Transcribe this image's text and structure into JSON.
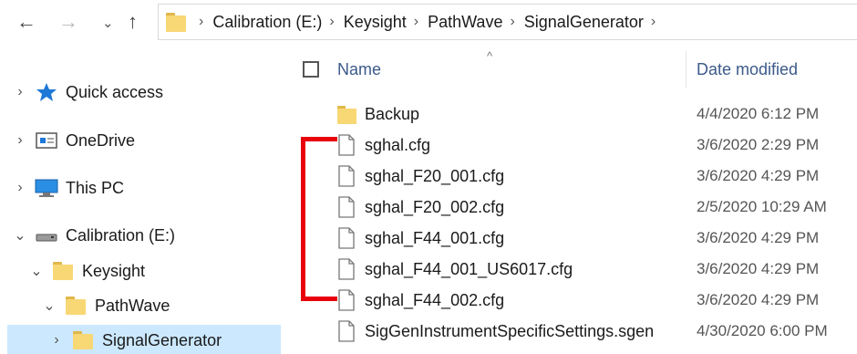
{
  "nav": {
    "back_glyph": "←",
    "forward_glyph": "→",
    "recent_glyph": "⌄",
    "up_glyph": "↑"
  },
  "address": {
    "breadcrumbs": [
      "Calibration (E:)",
      "Keysight",
      "PathWave",
      "SignalGenerator"
    ],
    "separator": "›"
  },
  "tree": {
    "items": [
      {
        "label": "Quick access",
        "icon": "star-icon",
        "chevron": "›"
      },
      {
        "label": "OneDrive",
        "icon": "onedrive-icon",
        "chevron": "›"
      },
      {
        "label": "This PC",
        "icon": "computer-icon",
        "chevron": "›"
      },
      {
        "label": "Calibration (E:)",
        "icon": "drive-icon",
        "chevron": "⌄"
      },
      {
        "label": "Keysight",
        "icon": "folder-icon",
        "chevron": "⌄"
      },
      {
        "label": "PathWave",
        "icon": "folder-icon",
        "chevron": "⌄"
      },
      {
        "label": "SignalGenerator",
        "icon": "folder-icon",
        "chevron": "›"
      }
    ]
  },
  "columns": {
    "name": "Name",
    "date": "Date modified",
    "sort_glyph": "^"
  },
  "files": [
    {
      "name": "Backup",
      "date": "4/4/2020 6:12 PM",
      "type": "folder"
    },
    {
      "name": "sghal.cfg",
      "date": "3/6/2020 2:29 PM",
      "type": "file"
    },
    {
      "name": "sghal_F20_001.cfg",
      "date": "3/6/2020 4:29 PM",
      "type": "file"
    },
    {
      "name": "sghal_F20_002.cfg",
      "date": "2/5/2020 10:29 AM",
      "type": "file"
    },
    {
      "name": "sghal_F44_001.cfg",
      "date": "3/6/2020 4:29 PM",
      "type": "file"
    },
    {
      "name": "sghal_F44_001_US6017.cfg",
      "date": "3/6/2020 4:29 PM",
      "type": "file"
    },
    {
      "name": "sghal_F44_002.cfg",
      "date": "3/6/2020 4:29 PM",
      "type": "file"
    },
    {
      "name": "SigGenInstrumentSpecificSettings.sgen",
      "date": "4/30/2020 6:00 PM",
      "type": "file"
    }
  ],
  "colors": {
    "folder": "#f8d775",
    "folder_dark": "#e0b84a",
    "selection": "#cce8ff",
    "annotation": "#e8000b",
    "header_text": "#3c5a8a"
  }
}
